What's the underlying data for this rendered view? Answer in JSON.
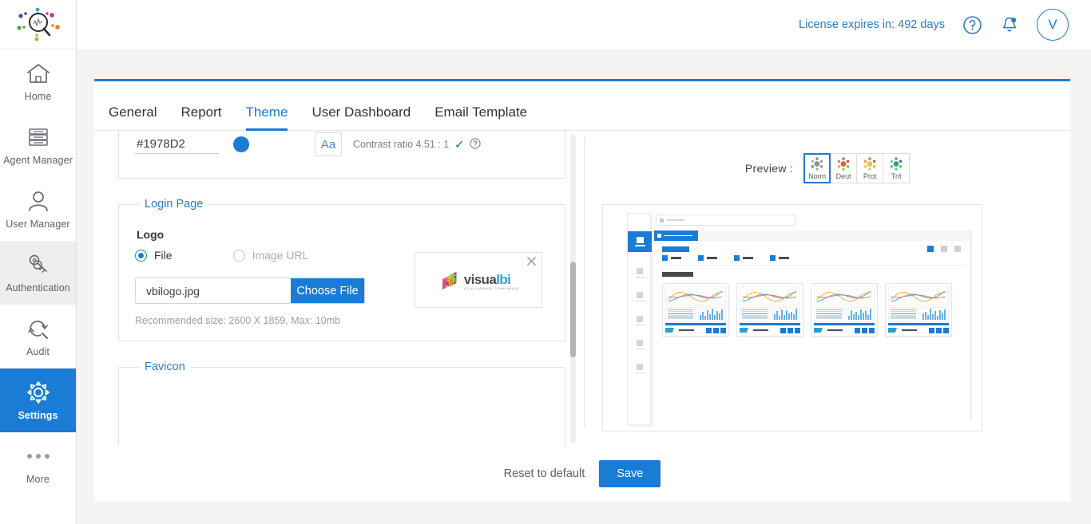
{
  "app": {
    "logo_icon": "magnifier-analytics-logo"
  },
  "sidebar": {
    "items": [
      {
        "label": "Home",
        "icon": "home-icon",
        "state": "default"
      },
      {
        "label": "Agent Manager",
        "icon": "server-rack-icon",
        "state": "default"
      },
      {
        "label": "User Manager",
        "icon": "user-icon",
        "state": "default"
      },
      {
        "label": "Authentication",
        "icon": "keys-icon",
        "state": "hovered"
      },
      {
        "label": "Audit",
        "icon": "audit-search-icon",
        "state": "default"
      },
      {
        "label": "Settings",
        "icon": "gear-icon",
        "state": "active"
      },
      {
        "label": "More",
        "icon": "ellipsis-icon",
        "state": "default"
      }
    ]
  },
  "topbar": {
    "license_text": "License expires in: 492 days",
    "help_icon": "help-circle-icon",
    "notification_icon": "bell-icon",
    "avatar_initial": "V"
  },
  "tabs": [
    {
      "label": "General",
      "active": false
    },
    {
      "label": "Report",
      "active": false
    },
    {
      "label": "Theme",
      "active": true
    },
    {
      "label": "User Dashboard",
      "active": false
    },
    {
      "label": "Email Template",
      "active": false
    }
  ],
  "theme_form": {
    "color": {
      "hex_value": "#1978D2",
      "hex_placeholder": "#RRGGBB",
      "swatch_color": "#1978D2",
      "sample_text": "Aa",
      "contrast_text": "Contrast ratio 4.51 : 1",
      "contrast_pass_icon": "check-icon",
      "contrast_help_icon": "help-circle-icon"
    },
    "login_page": {
      "legend": "Login Page",
      "logo_label": "Logo",
      "option_file": "File",
      "option_image_url": "Image URL",
      "selected_option": "File",
      "file_name": "vbilogo.jpg",
      "choose_file_label": "Choose File",
      "hint": "Recommended size: 2600 X 1859, Max: 10mb",
      "preview_logo_word_1": "visua",
      "preview_logo_word_2": "l",
      "preview_logo_word_3": "bi",
      "preview_logo_tagline": "LOOK FORWARD. THINK AHEAD.",
      "remove_icon": "close-icon"
    },
    "favicon": {
      "legend": "Favicon"
    }
  },
  "preview": {
    "label": "Preview :",
    "modes": [
      {
        "label": "Norm",
        "selected": true,
        "icon": "color-dots-normal-icon"
      },
      {
        "label": "Deut",
        "selected": false,
        "icon": "color-dots-deuteranopia-icon"
      },
      {
        "label": "Prot",
        "selected": false,
        "icon": "color-dots-protanopia-icon"
      },
      {
        "label": "Trit",
        "selected": false,
        "icon": "color-dots-tritanopia-icon"
      }
    ],
    "mockup_name": "dashboard-theme-preview"
  },
  "footer": {
    "reset_label": "Reset to default",
    "save_label": "Save"
  },
  "colors": {
    "accent": "#1A7CD5",
    "accent_text": "#2B7CC4",
    "pass_green": "#27AE44",
    "page_bg": "#F4F4F4"
  }
}
